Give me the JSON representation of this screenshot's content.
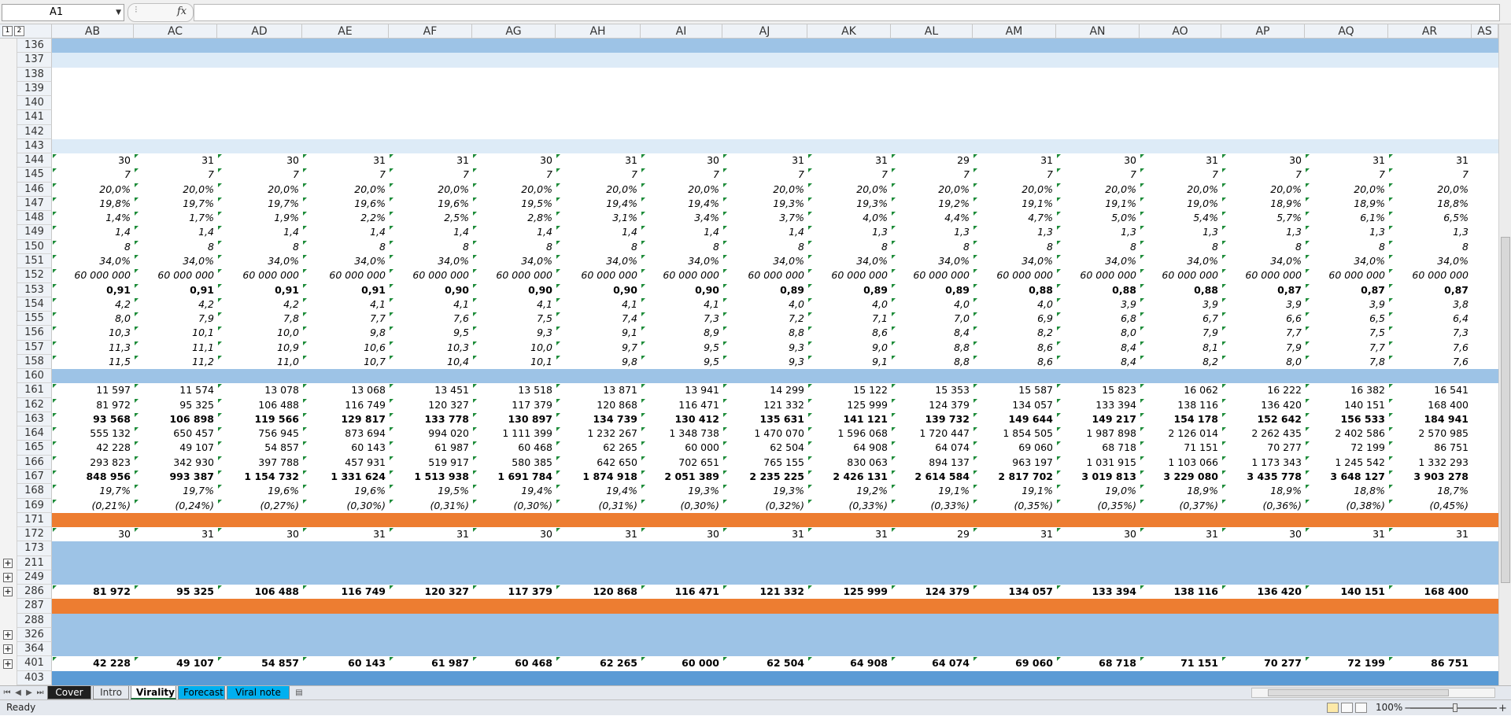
{
  "name_box": "A1",
  "formula_label": "fx",
  "formula_value": "",
  "outline_levels": [
    "1",
    "2"
  ],
  "columns": [
    "AB",
    "AC",
    "AD",
    "AE",
    "AF",
    "AG",
    "AH",
    "AI",
    "AJ",
    "AK",
    "AL",
    "AM",
    "AN",
    "AO",
    "AP",
    "AQ",
    "AR",
    "AS"
  ],
  "rows": [
    {
      "n": "136",
      "band": "#9dc3e6"
    },
    {
      "n": "137",
      "band": "#ddebf7"
    },
    {
      "n": "138"
    },
    {
      "n": "139"
    },
    {
      "n": "140"
    },
    {
      "n": "141"
    },
    {
      "n": "142"
    },
    {
      "n": "143",
      "band": "#ddebf7"
    },
    {
      "n": "144",
      "v": [
        "30",
        "31",
        "30",
        "31",
        "31",
        "30",
        "31",
        "30",
        "31",
        "31",
        "29",
        "31",
        "30",
        "31",
        "30",
        "31",
        "31"
      ]
    },
    {
      "n": "145",
      "v": [
        "7",
        "7",
        "7",
        "7",
        "7",
        "7",
        "7",
        "7",
        "7",
        "7",
        "7",
        "7",
        "7",
        "7",
        "7",
        "7",
        "7"
      ],
      "style": "i"
    },
    {
      "n": "146",
      "v": [
        "20,0%",
        "20,0%",
        "20,0%",
        "20,0%",
        "20,0%",
        "20,0%",
        "20,0%",
        "20,0%",
        "20,0%",
        "20,0%",
        "20,0%",
        "20,0%",
        "20,0%",
        "20,0%",
        "20,0%",
        "20,0%",
        "20,0%"
      ],
      "style": "i"
    },
    {
      "n": "147",
      "v": [
        "19,8%",
        "19,7%",
        "19,7%",
        "19,6%",
        "19,6%",
        "19,5%",
        "19,4%",
        "19,4%",
        "19,3%",
        "19,3%",
        "19,2%",
        "19,1%",
        "19,1%",
        "19,0%",
        "18,9%",
        "18,9%",
        "18,8%"
      ],
      "style": "i"
    },
    {
      "n": "148",
      "v": [
        "1,4%",
        "1,7%",
        "1,9%",
        "2,2%",
        "2,5%",
        "2,8%",
        "3,1%",
        "3,4%",
        "3,7%",
        "4,0%",
        "4,4%",
        "4,7%",
        "5,0%",
        "5,4%",
        "5,7%",
        "6,1%",
        "6,5%"
      ],
      "style": "i"
    },
    {
      "n": "149",
      "v": [
        "1,4",
        "1,4",
        "1,4",
        "1,4",
        "1,4",
        "1,4",
        "1,4",
        "1,4",
        "1,4",
        "1,3",
        "1,3",
        "1,3",
        "1,3",
        "1,3",
        "1,3",
        "1,3",
        "1,3"
      ],
      "style": "i"
    },
    {
      "n": "150",
      "v": [
        "8",
        "8",
        "8",
        "8",
        "8",
        "8",
        "8",
        "8",
        "8",
        "8",
        "8",
        "8",
        "8",
        "8",
        "8",
        "8",
        "8"
      ],
      "style": "i"
    },
    {
      "n": "151",
      "v": [
        "34,0%",
        "34,0%",
        "34,0%",
        "34,0%",
        "34,0%",
        "34,0%",
        "34,0%",
        "34,0%",
        "34,0%",
        "34,0%",
        "34,0%",
        "34,0%",
        "34,0%",
        "34,0%",
        "34,0%",
        "34,0%",
        "34,0%"
      ],
      "style": "i"
    },
    {
      "n": "152",
      "v": [
        "60 000 000",
        "60 000 000",
        "60 000 000",
        "60 000 000",
        "60 000 000",
        "60 000 000",
        "60 000 000",
        "60 000 000",
        "60 000 000",
        "60 000 000",
        "60 000 000",
        "60 000 000",
        "60 000 000",
        "60 000 000",
        "60 000 000",
        "60 000 000",
        "60 000 000"
      ],
      "style": "i"
    },
    {
      "n": "153",
      "v": [
        "0,91",
        "0,91",
        "0,91",
        "0,91",
        "0,90",
        "0,90",
        "0,90",
        "0,90",
        "0,89",
        "0,89",
        "0,89",
        "0,88",
        "0,88",
        "0,88",
        "0,87",
        "0,87",
        "0,87"
      ],
      "style": "b"
    },
    {
      "n": "154",
      "v": [
        "4,2",
        "4,2",
        "4,2",
        "4,1",
        "4,1",
        "4,1",
        "4,1",
        "4,1",
        "4,0",
        "4,0",
        "4,0",
        "4,0",
        "3,9",
        "3,9",
        "3,9",
        "3,9",
        "3,8"
      ],
      "style": "i"
    },
    {
      "n": "155",
      "v": [
        "8,0",
        "7,9",
        "7,8",
        "7,7",
        "7,6",
        "7,5",
        "7,4",
        "7,3",
        "7,2",
        "7,1",
        "7,0",
        "6,9",
        "6,8",
        "6,7",
        "6,6",
        "6,5",
        "6,4"
      ],
      "style": "i"
    },
    {
      "n": "156",
      "v": [
        "10,3",
        "10,1",
        "10,0",
        "9,8",
        "9,5",
        "9,3",
        "9,1",
        "8,9",
        "8,8",
        "8,6",
        "8,4",
        "8,2",
        "8,0",
        "7,9",
        "7,7",
        "7,5",
        "7,3"
      ],
      "style": "i"
    },
    {
      "n": "157",
      "v": [
        "11,3",
        "11,1",
        "10,9",
        "10,6",
        "10,3",
        "10,0",
        "9,7",
        "9,5",
        "9,3",
        "9,0",
        "8,8",
        "8,6",
        "8,4",
        "8,1",
        "7,9",
        "7,7",
        "7,6"
      ],
      "style": "i"
    },
    {
      "n": "158",
      "v": [
        "11,5",
        "11,2",
        "11,0",
        "10,7",
        "10,4",
        "10,1",
        "9,8",
        "9,5",
        "9,3",
        "9,1",
        "8,8",
        "8,6",
        "8,4",
        "8,2",
        "8,0",
        "7,8",
        "7,6"
      ],
      "style": "i"
    },
    {
      "n": "160",
      "band": "#9dc3e6"
    },
    {
      "n": "161",
      "v": [
        "11 597",
        "11 574",
        "13 078",
        "13 068",
        "13 451",
        "13 518",
        "13 871",
        "13 941",
        "14 299",
        "15 122",
        "15 353",
        "15 587",
        "15 823",
        "16 062",
        "16 222",
        "16 382",
        "16 541"
      ]
    },
    {
      "n": "162",
      "v": [
        "81 972",
        "95 325",
        "106 488",
        "116 749",
        "120 327",
        "117 379",
        "120 868",
        "116 471",
        "121 332",
        "125 999",
        "124 379",
        "134 057",
        "133 394",
        "138 116",
        "136 420",
        "140 151",
        "168 400"
      ]
    },
    {
      "n": "163",
      "v": [
        "93 568",
        "106 898",
        "119 566",
        "129 817",
        "133 778",
        "130 897",
        "134 739",
        "130 412",
        "135 631",
        "141 121",
        "139 732",
        "149 644",
        "149 217",
        "154 178",
        "152 642",
        "156 533",
        "184 941"
      ],
      "style": "b"
    },
    {
      "n": "164",
      "v": [
        "555 132",
        "650 457",
        "756 945",
        "873 694",
        "994 020",
        "1 111 399",
        "1 232 267",
        "1 348 738",
        "1 470 070",
        "1 596 068",
        "1 720 447",
        "1 854 505",
        "1 987 898",
        "2 126 014",
        "2 262 435",
        "2 402 586",
        "2 570 985"
      ]
    },
    {
      "n": "165",
      "v": [
        "42 228",
        "49 107",
        "54 857",
        "60 143",
        "61 987",
        "60 468",
        "62 265",
        "60 000",
        "62 504",
        "64 908",
        "64 074",
        "69 060",
        "68 718",
        "71 151",
        "70 277",
        "72 199",
        "86 751"
      ]
    },
    {
      "n": "166",
      "v": [
        "293 823",
        "342 930",
        "397 788",
        "457 931",
        "519 917",
        "580 385",
        "642 650",
        "702 651",
        "765 155",
        "830 063",
        "894 137",
        "963 197",
        "1 031 915",
        "1 103 066",
        "1 173 343",
        "1 245 542",
        "1 332 293"
      ]
    },
    {
      "n": "167",
      "v": [
        "848 956",
        "993 387",
        "1 154 732",
        "1 331 624",
        "1 513 938",
        "1 691 784",
        "1 874 918",
        "2 051 389",
        "2 235 225",
        "2 426 131",
        "2 614 584",
        "2 817 702",
        "3 019 813",
        "3 229 080",
        "3 435 778",
        "3 648 127",
        "3 903 278"
      ],
      "style": "b"
    },
    {
      "n": "168",
      "v": [
        "19,7%",
        "19,7%",
        "19,6%",
        "19,6%",
        "19,5%",
        "19,4%",
        "19,4%",
        "19,3%",
        "19,3%",
        "19,2%",
        "19,1%",
        "19,1%",
        "19,0%",
        "18,9%",
        "18,9%",
        "18,8%",
        "18,7%"
      ],
      "style": "i"
    },
    {
      "n": "169",
      "v": [
        "(0,21%)",
        "(0,24%)",
        "(0,27%)",
        "(0,30%)",
        "(0,31%)",
        "(0,30%)",
        "(0,31%)",
        "(0,30%)",
        "(0,32%)",
        "(0,33%)",
        "(0,33%)",
        "(0,35%)",
        "(0,35%)",
        "(0,37%)",
        "(0,36%)",
        "(0,38%)",
        "(0,45%)"
      ],
      "style": "i"
    },
    {
      "n": "171",
      "band": "#ed7d31"
    },
    {
      "n": "172",
      "v": [
        "30",
        "31",
        "30",
        "31",
        "31",
        "30",
        "31",
        "30",
        "31",
        "31",
        "29",
        "31",
        "30",
        "31",
        "30",
        "31",
        "31"
      ]
    },
    {
      "n": "173",
      "band": "#9dc3e6"
    },
    {
      "n": "211",
      "band": "#9dc3e6",
      "plus": true
    },
    {
      "n": "249",
      "band": "#9dc3e6",
      "plus": true
    },
    {
      "n": "286",
      "v": [
        "81 972",
        "95 325",
        "106 488",
        "116 749",
        "120 327",
        "117 379",
        "120 868",
        "116 471",
        "121 332",
        "125 999",
        "124 379",
        "134 057",
        "133 394",
        "138 116",
        "136 420",
        "140 151",
        "168 400"
      ],
      "style": "b",
      "plus": true
    },
    {
      "n": "287",
      "band": "#ed7d31"
    },
    {
      "n": "288",
      "band": "#9dc3e6"
    },
    {
      "n": "326",
      "band": "#9dc3e6",
      "plus": true
    },
    {
      "n": "364",
      "band": "#9dc3e6",
      "plus": true
    },
    {
      "n": "401",
      "v": [
        "42 228",
        "49 107",
        "54 857",
        "60 143",
        "61 987",
        "60 468",
        "62 265",
        "60 000",
        "62 504",
        "64 908",
        "64 074",
        "69 060",
        "68 718",
        "71 151",
        "70 277",
        "72 199",
        "86 751"
      ],
      "style": "b",
      "plus": true
    },
    {
      "n": "403",
      "band": "#5b9bd5"
    }
  ],
  "sheet_tabs": [
    {
      "label": "Cover",
      "color": "#1f1f1f",
      "text": "#ffffff"
    },
    {
      "label": "Intro",
      "color": "#e4e8ee",
      "text": "#333333"
    },
    {
      "label": "Virality",
      "color": "#ffffff",
      "text": "#000000",
      "active": true
    },
    {
      "label": "Forecast",
      "color": "#00b0f0",
      "text": "#000000"
    },
    {
      "label": "Viral note",
      "color": "#00b0f0",
      "text": "#000000"
    }
  ],
  "status": {
    "ready": "Ready",
    "zoom": "100%"
  }
}
